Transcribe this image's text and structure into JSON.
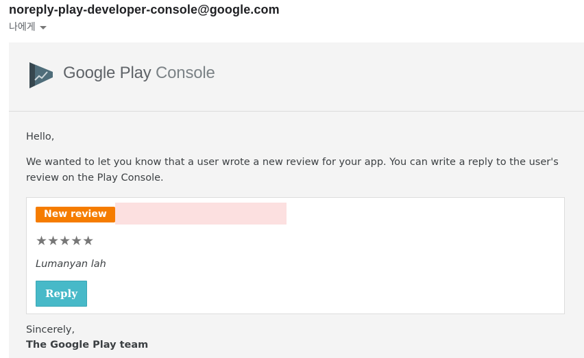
{
  "email": {
    "sender": "noreply-play-developer-console@google.com",
    "recipient_label": "나에게"
  },
  "logo": {
    "brand": "Google Play",
    "product": "Console"
  },
  "content": {
    "greeting": "Hello,",
    "message": "We wanted to let you know that a user wrote a new review for your app. You can write a reply to the user's review on the Play Console.",
    "review": {
      "badge": "New review",
      "rating": 5,
      "stars": "★★★★★",
      "text": "Lumanyan lah",
      "reply_label": "Reply"
    },
    "signoff": "Sincerely,",
    "signature": "The Google Play team"
  },
  "colors": {
    "badge_bg": "#f57c00",
    "reply_bg": "#47b9c8",
    "card_bg": "#f4f4f4",
    "redaction": "#fce0e0"
  }
}
